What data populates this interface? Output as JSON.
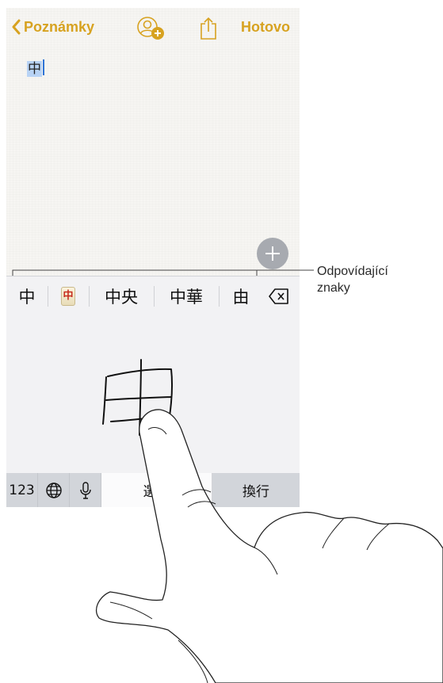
{
  "navbar": {
    "back_label": "Poznámky",
    "done_label": "Hotovo"
  },
  "note": {
    "text": "中"
  },
  "candidates": [
    {
      "kind": "text",
      "label": "中"
    },
    {
      "kind": "emoji",
      "label": "中",
      "icon": "mahjong-red-dragon-icon"
    },
    {
      "kind": "text",
      "label": "中央"
    },
    {
      "kind": "text",
      "label": "中華"
    },
    {
      "kind": "text",
      "label": "由"
    }
  ],
  "bottom_bar": {
    "numbers_label": "123",
    "select_label": "選定",
    "return_label": "換行"
  },
  "callout": {
    "label": "Odpovídající\nznaky"
  },
  "colors": {
    "accent": "#d7a220",
    "keyboard_bg": "#f2f2f4",
    "key_dark": "#d2d5da"
  },
  "icons": {
    "back": "chevron-left-icon",
    "collaborate": "add-person-icon",
    "share": "share-icon",
    "add": "plus-icon",
    "delete": "delete-backspace-icon",
    "globe": "globe-icon",
    "microphone": "microphone-icon"
  }
}
